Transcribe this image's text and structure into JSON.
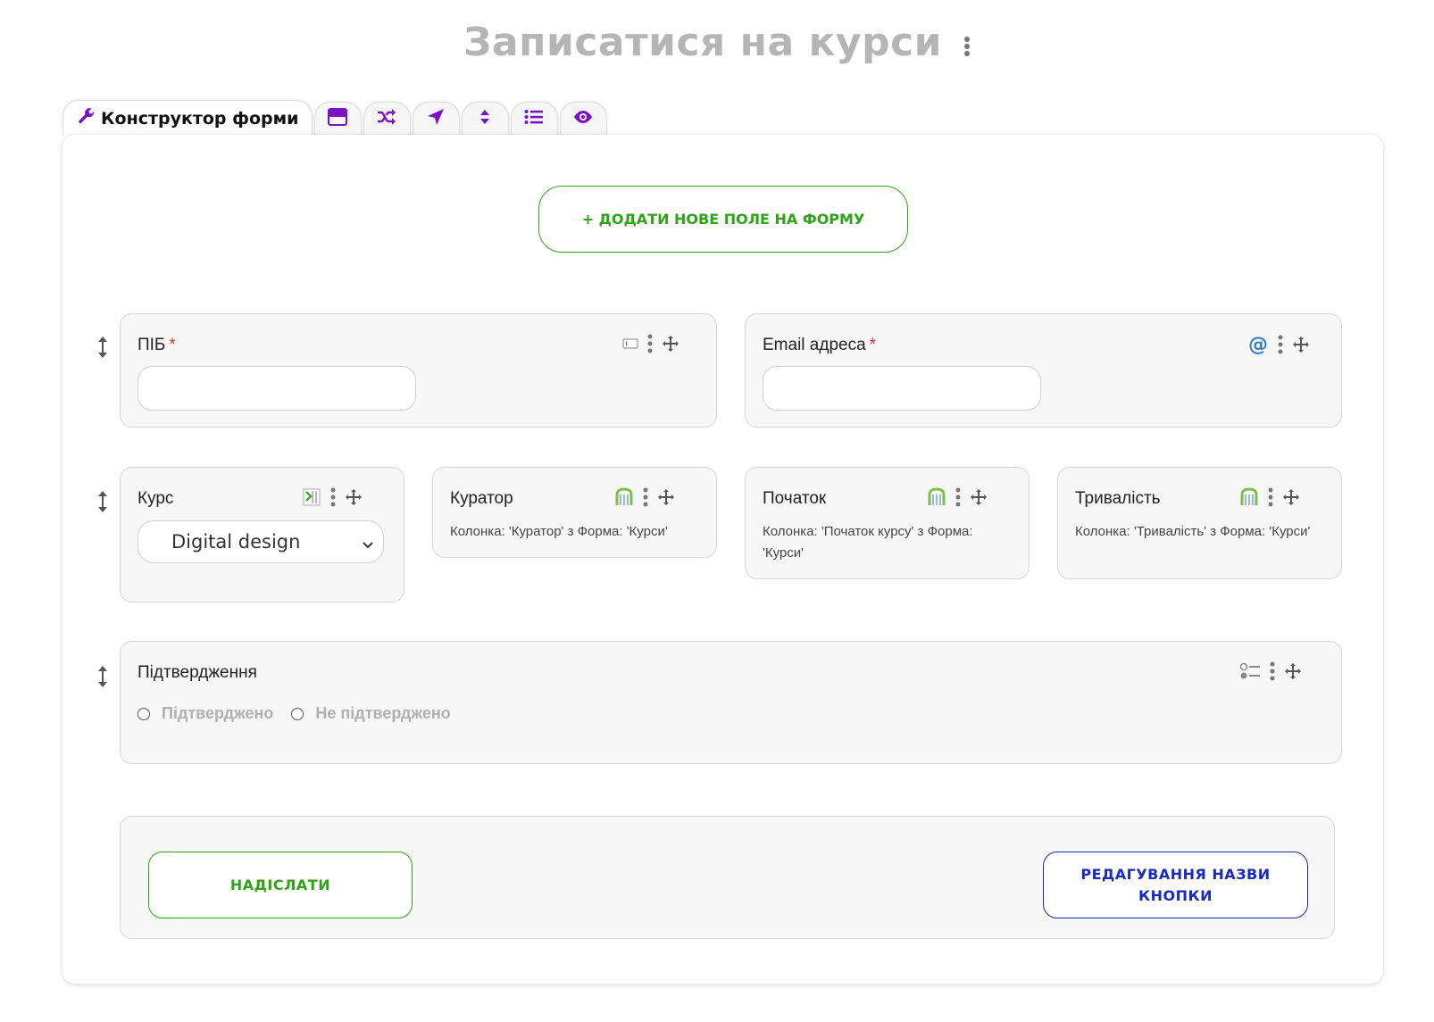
{
  "page": {
    "title": "Записатися на курси"
  },
  "tabs": {
    "builder_label": "Конструктор форми",
    "icons": [
      "form-window-icon",
      "shuffle-icon",
      "location-arrow-icon",
      "sort-icon",
      "list-icon",
      "eye-icon"
    ]
  },
  "toolbar": {
    "add_field_label": "+ ДОДАТИ НОВЕ ПОЛЕ НА ФОРМУ"
  },
  "fields": {
    "name": {
      "label": "ПІБ",
      "required_mark": "*",
      "value": ""
    },
    "email": {
      "label": "Email адреса",
      "required_mark": "*",
      "value": ""
    },
    "course": {
      "label": "Курс",
      "selected": "Digital design"
    },
    "curator": {
      "label": "Куратор",
      "linked": "Колонка: 'Куратор' з Форма: 'Курси'"
    },
    "start": {
      "label": "Початок",
      "linked": "Колонка: 'Початок курсу' з Форма: 'Курси'"
    },
    "duration": {
      "label": "Тривалість",
      "linked": "Колонка: 'Тривалість' з Форма: 'Курси'"
    },
    "confirmation": {
      "label": "Підтвердження",
      "options": [
        "Підтверджено",
        "Не підтверджено"
      ]
    }
  },
  "footer": {
    "submit_label": "НАДІСЛАТИ",
    "rename_label": "РЕДАГУВАННЯ НАЗВИ КНОПКИ"
  },
  "colors": {
    "accent_purple": "#7a12c4",
    "green": "#2ea316",
    "blue": "#1a2abf",
    "required": "#d9352b"
  }
}
